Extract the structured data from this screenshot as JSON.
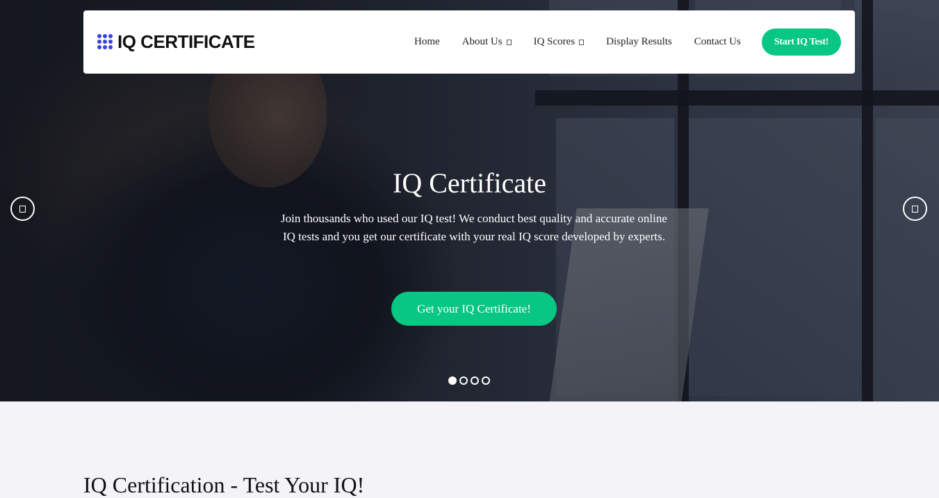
{
  "brand": {
    "logo_text": "IQ CERTIFICATE",
    "logo_color": "#3a42e0"
  },
  "nav": {
    "items": [
      {
        "label": "Home",
        "has_dropdown": false
      },
      {
        "label": "About Us",
        "has_dropdown": true
      },
      {
        "label": "IQ Scores",
        "has_dropdown": true
      },
      {
        "label": "Display Results",
        "has_dropdown": false
      },
      {
        "label": "Contact Us",
        "has_dropdown": false
      }
    ],
    "cta_label": "Start IQ Test!"
  },
  "hero": {
    "title": "IQ Certificate",
    "text": "Join thousands who used our IQ test! We conduct best quality and accurate online IQ tests and you get our certificate with your real IQ score developed by experts.",
    "button_label": "Get your IQ Certificate!",
    "prev_icon": "chevron-left-icon",
    "next_icon": "chevron-right-icon",
    "slides_count": 4,
    "active_slide": 1
  },
  "colors": {
    "accent": "#07c783",
    "page_background": "#f4f4f8"
  },
  "section": {
    "heading": "IQ Certification - Test Your IQ!"
  }
}
